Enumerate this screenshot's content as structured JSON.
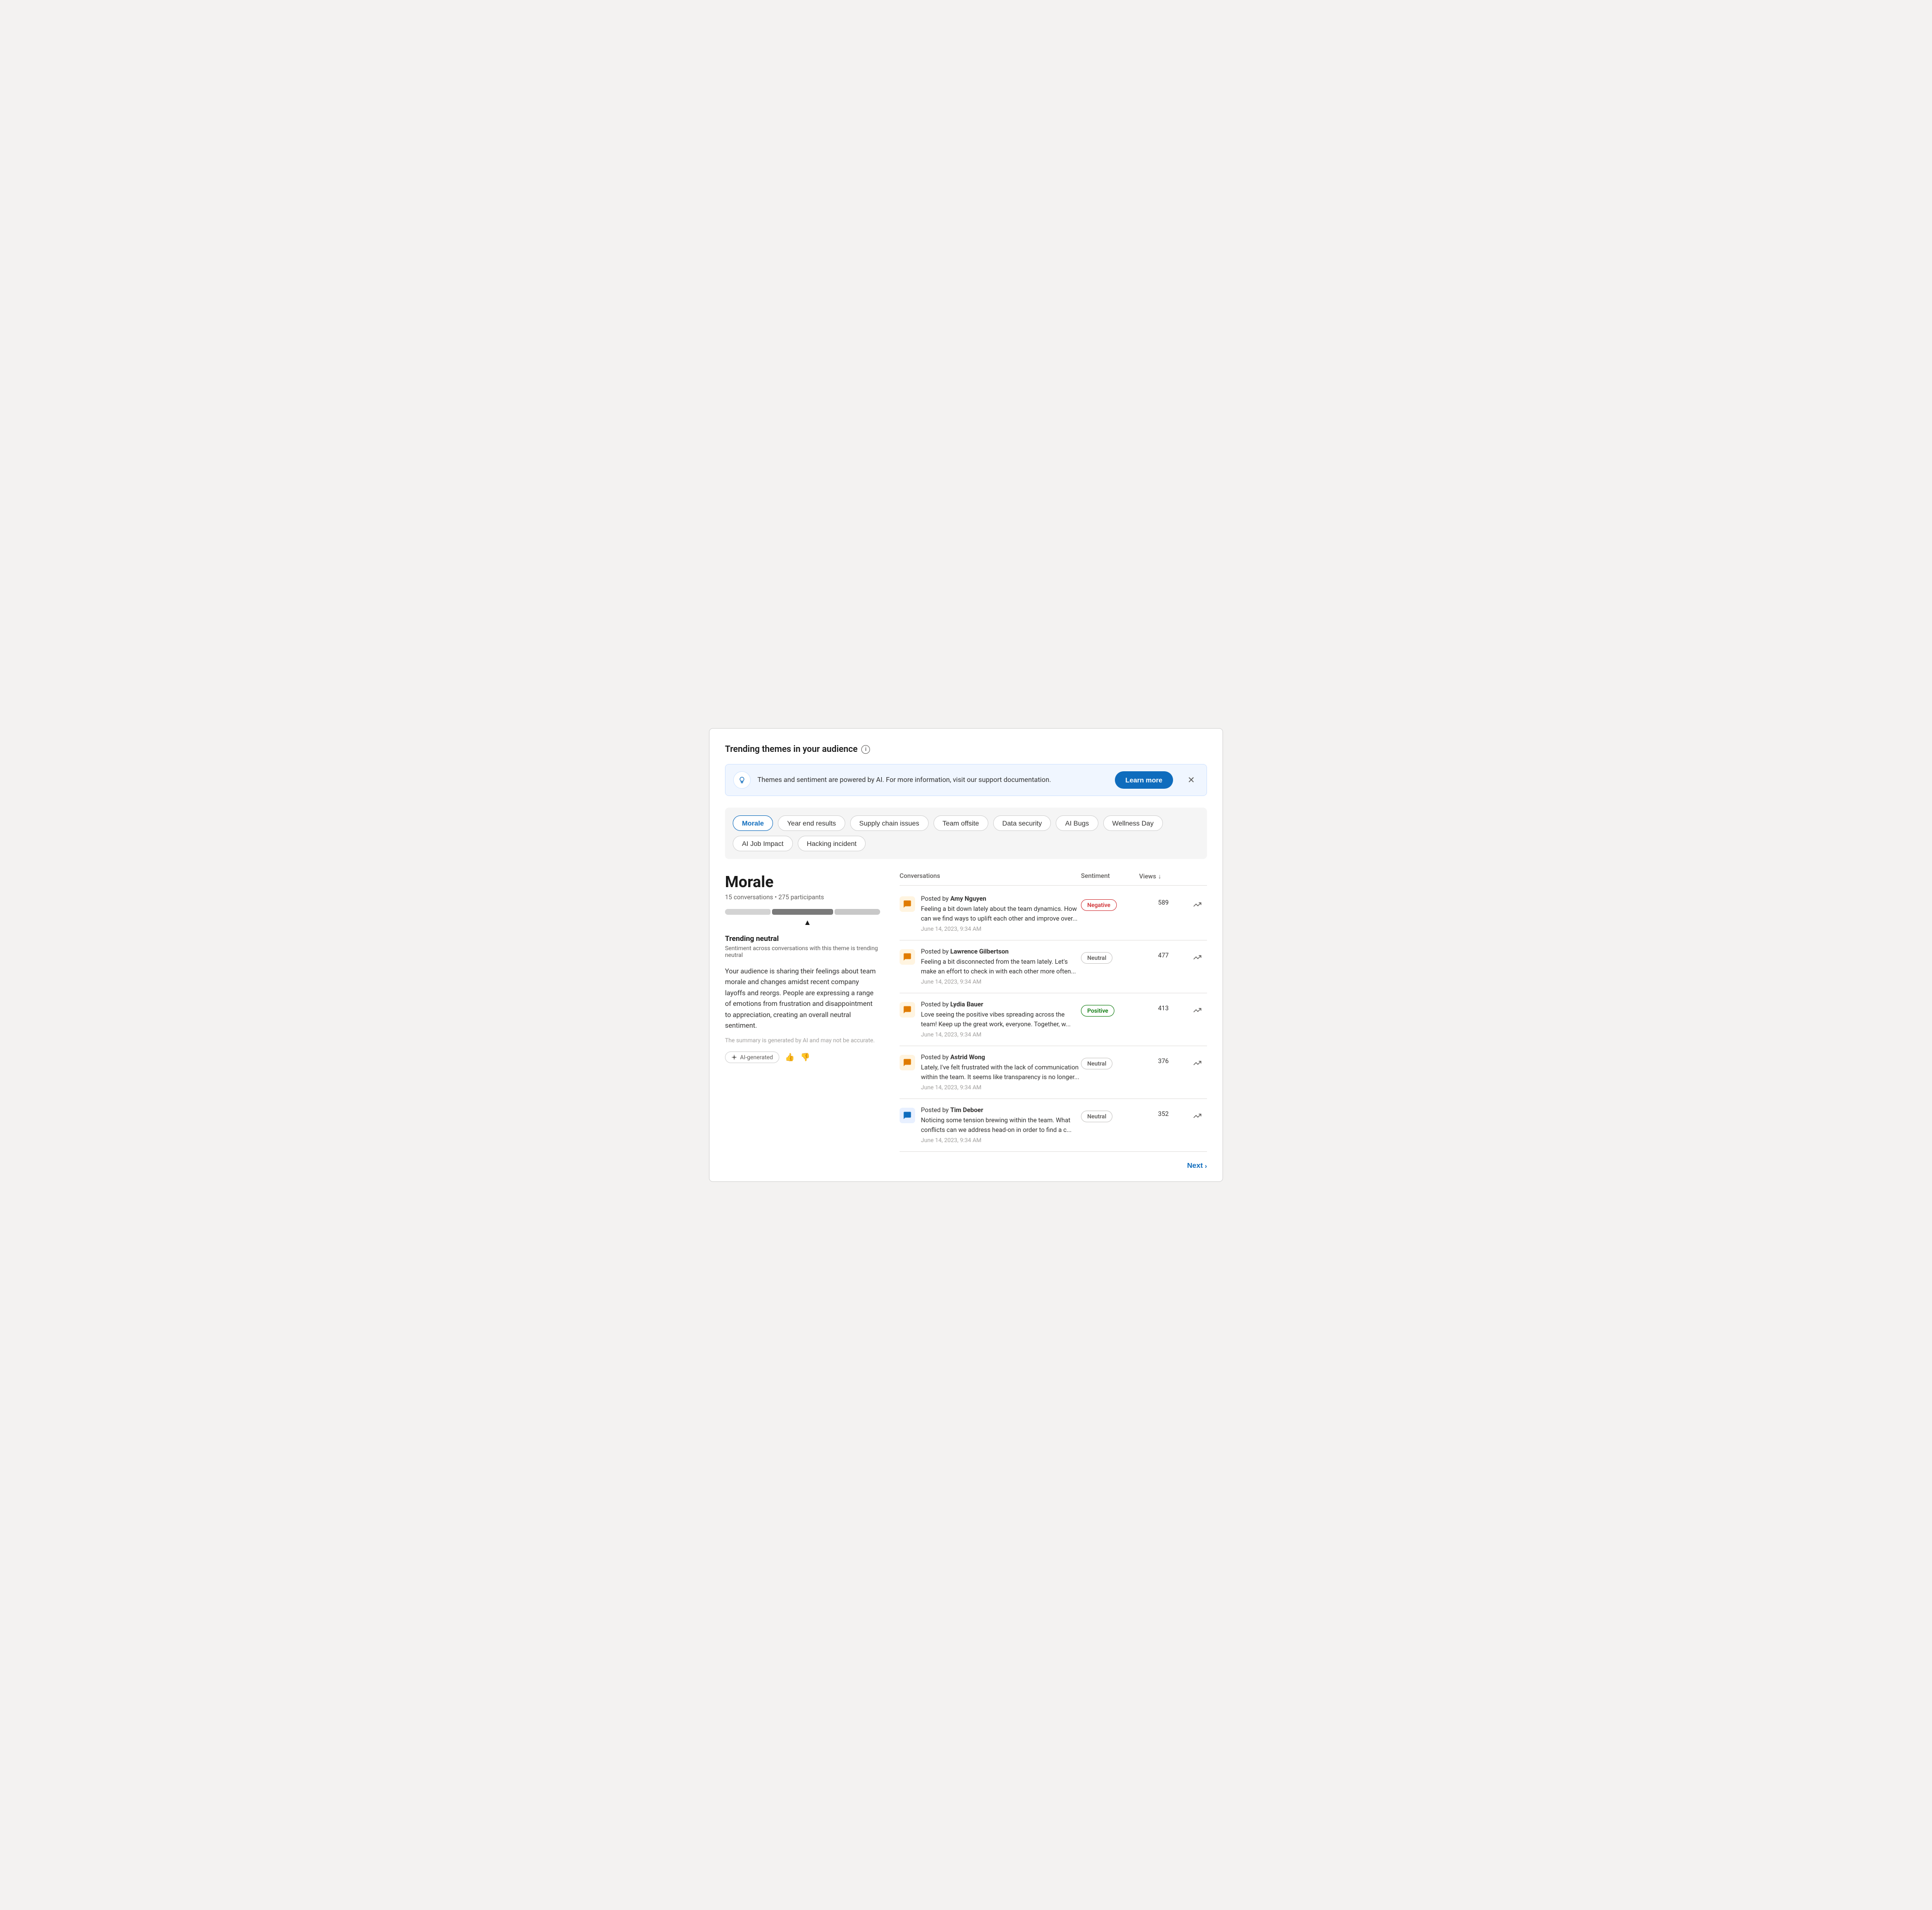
{
  "page": {
    "title": "Trending themes in your audience"
  },
  "banner": {
    "text": "Themes and sentiment are powered by AI. For more information, visit our support documentation.",
    "learn_more_label": "Learn more",
    "icon_label": "ai-bulb-icon"
  },
  "themes": {
    "chips": [
      {
        "id": "morale",
        "label": "Morale",
        "active": true
      },
      {
        "id": "year-end-results",
        "label": "Year end results",
        "active": false
      },
      {
        "id": "supply-chain-issues",
        "label": "Supply chain issues",
        "active": false
      },
      {
        "id": "team-offsite",
        "label": "Team offsite",
        "active": false
      },
      {
        "id": "data-security",
        "label": "Data security",
        "active": false
      },
      {
        "id": "ai-bugs",
        "label": "AI Bugs",
        "active": false
      },
      {
        "id": "wellness-day",
        "label": "Wellness Day",
        "active": false
      },
      {
        "id": "ai-job-impact",
        "label": "AI Job Impact",
        "active": false
      },
      {
        "id": "hacking-incident",
        "label": "Hacking incident",
        "active": false
      }
    ]
  },
  "selected_theme": {
    "title": "Morale",
    "conversations_count": "15 conversations",
    "participants_count": "275 participants",
    "trending_label": "Trending neutral",
    "trending_sublabel": "Sentiment across conversations with this theme is trending neutral",
    "summary": "Your audience is sharing their feelings about team morale and changes amidst recent company layoffs and reorgs. People are expressing a range of emotions from frustration and disappointment to appreciation, creating an overall neutral sentiment.",
    "ai_disclaimer": "The summary is generated by AI and may not be accurate.",
    "ai_badge_label": "AI-generated",
    "thumbup_label": "👍",
    "thumbdown_label": "👎"
  },
  "table": {
    "columns": {
      "conversations": "Conversations",
      "sentiment": "Sentiment",
      "views": "Views",
      "views_sort": "↓"
    },
    "rows": [
      {
        "author": "Amy Nguyen",
        "posted_by": "Posted by",
        "text": "Feeling a bit down lately about the team dynamics. How can we find ways to uplift each other and improve over...",
        "date": "June 14, 2023, 9:34 AM",
        "sentiment": "Negative",
        "sentiment_type": "negative",
        "views": "589",
        "icon_color": "orange"
      },
      {
        "author": "Lawrence Gilbertson",
        "posted_by": "Posted by",
        "text": "Feeling a bit disconnected from the team lately. Let's make an effort to check in with each other more often...",
        "date": "June 14, 2023, 9:34 AM",
        "sentiment": "Neutral",
        "sentiment_type": "neutral",
        "views": "477",
        "icon_color": "orange"
      },
      {
        "author": "Lydia Bauer",
        "posted_by": "Posted by",
        "text": "Love seeing the positive vibes spreading across the team! Keep up the great work, everyone. Together, w...",
        "date": "June 14, 2023, 9:34 AM",
        "sentiment": "Positive",
        "sentiment_type": "positive",
        "views": "413",
        "icon_color": "orange"
      },
      {
        "author": "Astrid Wong",
        "posted_by": "Posted by",
        "text": "Lately, I've felt frustrated with the lack of communication within the team. It seems like transparency is no longer...",
        "date": "June 14, 2023, 9:34 AM",
        "sentiment": "Neutral",
        "sentiment_type": "neutral",
        "views": "376",
        "icon_color": "orange"
      },
      {
        "author": "Tim Deboer",
        "posted_by": "Posted by",
        "text": "Noticing some tension brewing within the team. What conflicts can we address head-on in order to find a c...",
        "date": "June 14, 2023, 9:34 AM",
        "sentiment": "Neutral",
        "sentiment_type": "neutral",
        "views": "352",
        "icon_color": "blue"
      }
    ]
  },
  "pagination": {
    "next_label": "Next"
  }
}
